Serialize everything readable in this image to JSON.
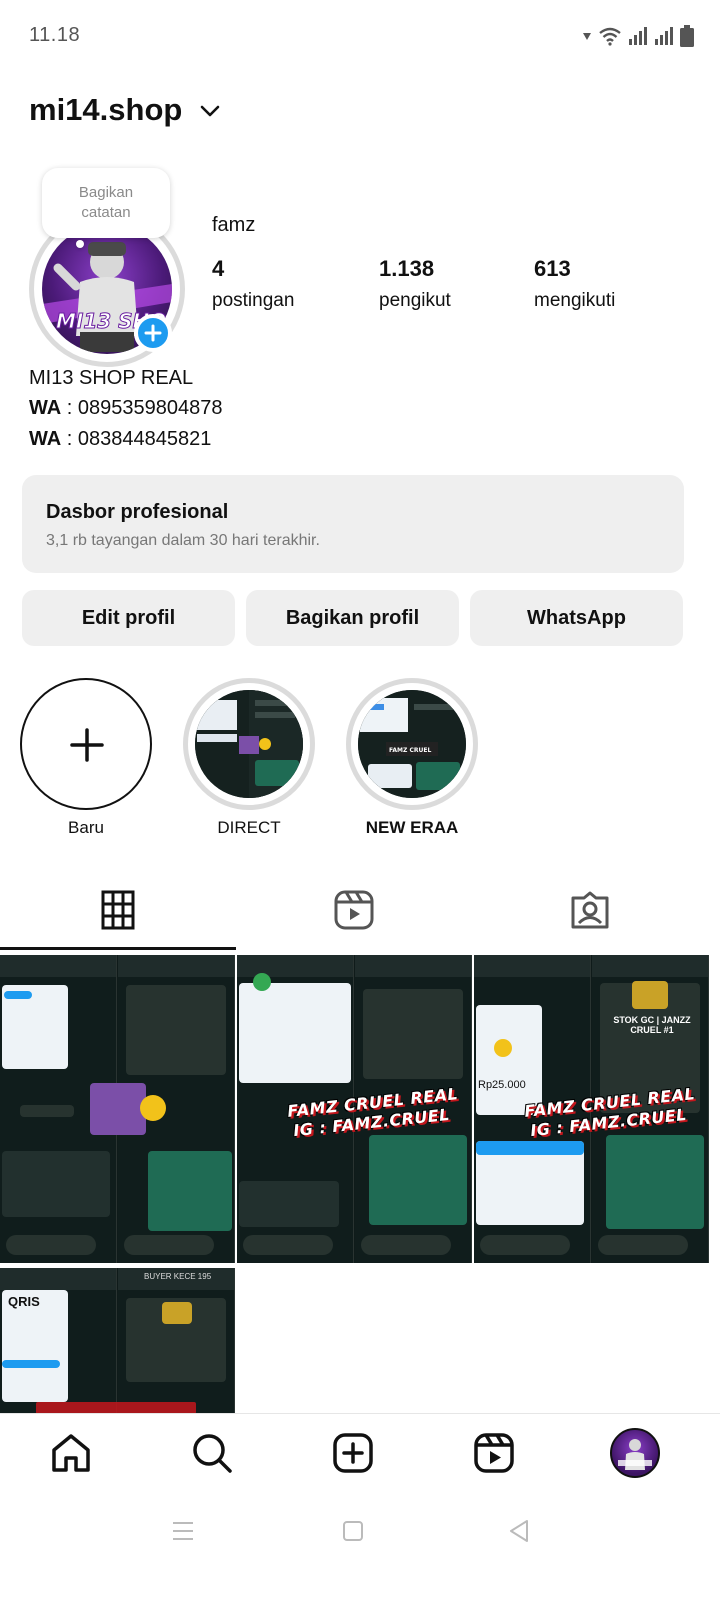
{
  "status_bar": {
    "time": "11.18"
  },
  "header": {
    "username": "mi14.shop"
  },
  "profile": {
    "note_text": "Bagikan catatan",
    "display_name": "famz",
    "stats": [
      {
        "value": "4",
        "label": "postingan"
      },
      {
        "value": "1.138",
        "label": "pengikut"
      },
      {
        "value": "613",
        "label": "mengikuti"
      }
    ],
    "bio": {
      "line1": "MI13 SHOP REAL",
      "wa_label": "WA",
      "wa1": " : 0895359804878",
      "wa2": " : 083844845821"
    }
  },
  "dashboard": {
    "title": "Dasbor profesional",
    "subtitle": "3,1 rb tayangan dalam 30 hari terakhir."
  },
  "buttons": {
    "edit": "Edit profil",
    "share": "Bagikan profil",
    "whatsapp": "WhatsApp"
  },
  "highlights": [
    {
      "label": "Baru"
    },
    {
      "label": "DIRECT"
    },
    {
      "label": "NEW ERAA"
    }
  ],
  "tabs": [
    "grid-icon",
    "reels-icon",
    "tagged-icon"
  ],
  "posts": {
    "watermark_1": "FAMZ CRUEL REAL",
    "watermark_2": "IG : FAMZ.CRUEL",
    "post3_amount": "Rp25.000",
    "post4_title": "STOK GC | JANZZ CRUEL #1",
    "post5_logo": "QRIS",
    "post5_chat": "BUYER KECE 195"
  },
  "colors": {
    "accent_blue": "#1d9bf0",
    "button_bg": "#efefef",
    "chat_bg": "#0f1b1a",
    "bubble_green": "#1f6b54"
  }
}
